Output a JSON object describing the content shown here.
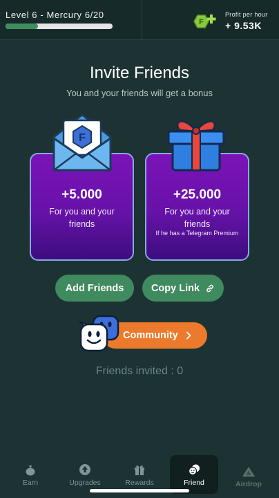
{
  "header": {
    "level_text": "Level 6 - Mercury  6/20",
    "level_progress": 0.3,
    "profit_label": "Profit per hour",
    "profit_value": "+ 9.53K"
  },
  "invite": {
    "title": "Invite Friends",
    "subtitle": "You and your friends will get a bonus",
    "cards": [
      {
        "value": "+5.000",
        "desc": "For you and your friends",
        "note": ""
      },
      {
        "value": "+25.000",
        "desc": "For you and your friends",
        "note": "If he has a Telegram Premium"
      }
    ]
  },
  "actions": {
    "add_friends": "Add Friends",
    "copy_link": "Copy Link",
    "community": "Community"
  },
  "friends_invited": "Friends invited : 0",
  "nav": {
    "items": [
      {
        "label": "Earn",
        "icon": "money-bag-icon"
      },
      {
        "label": "Upgrades",
        "icon": "upgrade-arrow-icon"
      },
      {
        "label": "Rewards",
        "icon": "gift-icon"
      },
      {
        "label": "Friend",
        "icon": "friends-icon",
        "active": true
      },
      {
        "label": "Airdrop",
        "icon": "airdrop-icon"
      }
    ]
  },
  "colors": {
    "background": "#1d3333",
    "accent_green": "#3f8a5e",
    "accent_orange": "#ec7a2c",
    "card_purple": "#6612a8",
    "card_border": "#86a9e6"
  }
}
